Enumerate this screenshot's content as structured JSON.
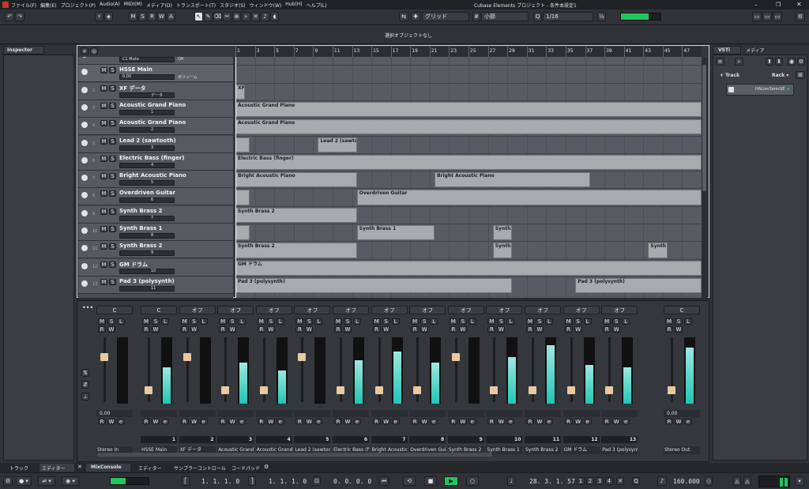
{
  "titlebar": {
    "menus": [
      "ファイル(F)",
      "編集(E)",
      "プロジェクト(P)",
      "Audio(A)",
      "MIDI(M)",
      "メディア(D)",
      "トランスポート(T)",
      "スタジオ(S)",
      "ウィンドウ(W)",
      "Hub(H)",
      "ヘルプ(L)"
    ],
    "title": "Cubase Elements プロジェクト - 条件本設定1"
  },
  "toolbar": {
    "mode_buttons": [
      "M",
      "S",
      "R",
      "W",
      "A"
    ],
    "snap_mode": "グリッド",
    "grid_type": "小節",
    "quantize": "1/16"
  },
  "infobar": {
    "status": "選択オブジェクトなし"
  },
  "left_zone": {
    "tab": "Inspector"
  },
  "bottom_tabs_left": [
    "トラック",
    "エディター"
  ],
  "bottom_tabs_lower": [
    "MixConsole",
    "エディター",
    "サンプラーコントロール",
    "コードパッド"
  ],
  "ruler_bars": [
    "1",
    "3",
    "5",
    "7",
    "9",
    "11",
    "13",
    "15",
    "17",
    "19",
    "21",
    "23",
    "25",
    "27",
    "29",
    "31",
    "33",
    "35",
    "37",
    "39",
    "41",
    "43",
    "45",
    "47"
  ],
  "tracks": [
    {
      "num": "",
      "name": "HALion Sonic SE",
      "sub": "C1 Mute",
      "extra": "Off"
    },
    {
      "num": "",
      "name": "HSSE Main",
      "sub": "0.00",
      "extra": "ボリューム"
    },
    {
      "num": "2",
      "name": "XF データ",
      "ch": "データ"
    },
    {
      "num": "3",
      "name": "Acoustic Grand Piano",
      "ch": "1"
    },
    {
      "num": "4",
      "name": "Acoustic Grand Piano",
      "ch": "2"
    },
    {
      "num": "5",
      "name": "Lead 2 (sawtooth)",
      "ch": "3"
    },
    {
      "num": "6",
      "name": "Electric Bass (finger)",
      "ch": "4"
    },
    {
      "num": "7",
      "name": "Bright Acoustic Piano",
      "ch": "5"
    },
    {
      "num": "8",
      "name": "Overdriven Guitar",
      "ch": "6"
    },
    {
      "num": "9",
      "name": "Synth Brass 2",
      "ch": "7"
    },
    {
      "num": "10",
      "name": "Synth Brass 1",
      "ch": "8"
    },
    {
      "num": "11",
      "name": "Synth Brass 2",
      "ch": "9"
    },
    {
      "num": "12",
      "name": "GM ドラム",
      "ch": "10"
    },
    {
      "num": "13",
      "name": "Pad 3 (polysynth)",
      "ch": "11"
    }
  ],
  "events": [
    {
      "row": 2,
      "start": 0,
      "end": 1,
      "label": "XF デー"
    },
    {
      "row": 3,
      "start": 0,
      "end": 48,
      "label": "Acoustic Grand Piano"
    },
    {
      "row": 4,
      "start": 0,
      "end": 48,
      "label": "Acoustic Grand Piano"
    },
    {
      "row": 5,
      "start": 0,
      "end": 1.5,
      "label": ""
    },
    {
      "row": 5,
      "start": 8.5,
      "end": 12.5,
      "label": "Lead 2 (sawtoot"
    },
    {
      "row": 6,
      "start": 0,
      "end": 48,
      "label": "Electric Bass (finger)"
    },
    {
      "row": 7,
      "start": 0,
      "end": 12.5,
      "label": "Bright Acoustic Piano"
    },
    {
      "row": 7,
      "start": 20.5,
      "end": 36.5,
      "label": "Bright Acoustic Piano"
    },
    {
      "row": 8,
      "start": 0,
      "end": 1.5,
      "label": ""
    },
    {
      "row": 8,
      "start": 12.5,
      "end": 48,
      "label": "Overdriven Guitar"
    },
    {
      "row": 9,
      "start": 0,
      "end": 12.5,
      "label": "Synth Brass 2"
    },
    {
      "row": 10,
      "start": 0,
      "end": 1.5,
      "label": ""
    },
    {
      "row": 10,
      "start": 12.5,
      "end": 20.5,
      "label": "Synth Brass 1"
    },
    {
      "row": 10,
      "start": 26.5,
      "end": 28.5,
      "label": "Synth B"
    },
    {
      "row": 11,
      "start": 0,
      "end": 12.5,
      "label": "Synth Brass 2"
    },
    {
      "row": 11,
      "start": 26.5,
      "end": 28.5,
      "label": "Synth B"
    },
    {
      "row": 11,
      "start": 42.5,
      "end": 44.5,
      "label": "Synth B"
    },
    {
      "row": 12,
      "start": 0,
      "end": 48,
      "label": "GM ドラム"
    },
    {
      "row": 13,
      "start": 0,
      "end": 28.5,
      "label": "Pad 3 (polysynth)"
    },
    {
      "row": 13,
      "start": 35,
      "end": 48,
      "label": "Pad 3 (polysynth)"
    }
  ],
  "mixer": {
    "input": {
      "name": "Stereo In",
      "pan": "C",
      "value": "0.00"
    },
    "channels": [
      {
        "name": "HSSE Main",
        "num": "1",
        "pan": "C",
        "level": 0.55
      },
      {
        "name": "XF データ",
        "num": "2",
        "pan": "オフ",
        "level": 0.0
      },
      {
        "name": "Acoustic Grand",
        "num": "3",
        "pan": "オフ",
        "level": 0.62
      },
      {
        "name": "Acoustic Grand",
        "num": "4",
        "pan": "オフ",
        "level": 0.5
      },
      {
        "name": "Lead 2 (sawtoo",
        "num": "5",
        "pan": "オフ",
        "level": 0.0
      },
      {
        "name": "Electric Bass (fi",
        "num": "6",
        "pan": "オフ",
        "level": 0.66
      },
      {
        "name": "Bright Acoustic",
        "num": "7",
        "pan": "オフ",
        "level": 0.78
      },
      {
        "name": "Overdriven Gui",
        "num": "8",
        "pan": "オフ",
        "level": 0.62
      },
      {
        "name": "Synth Brass 2",
        "num": "9",
        "pan": "オフ",
        "level": 0.0
      },
      {
        "name": "Synth Brass 1",
        "num": "10",
        "pan": "オフ",
        "level": 0.7
      },
      {
        "name": "Synth Brass 2",
        "num": "11",
        "pan": "オフ",
        "level": 0.88
      },
      {
        "name": "GM ドラム",
        "num": "12",
        "pan": "オフ",
        "level": 0.58
      },
      {
        "name": "Pad 3 (polysynt",
        "num": "13",
        "pan": "オフ",
        "level": 0.55
      }
    ],
    "output": {
      "name": "Stereo Out",
      "pan": "C",
      "value": "0.00",
      "level": 0.85
    }
  },
  "right_zone": {
    "tabs": [
      "VSTi",
      "メディア"
    ],
    "track_label": "Track",
    "rack_label": "Rack",
    "instrument": "HALionSonicSE"
  },
  "transport": {
    "left_locator": "1. 1. 1. 0",
    "right_locator": "1. 1. 1. 0",
    "start": "0. 0. 0. 0",
    "position": "28. 3. 1. 57",
    "tempo": "160.000",
    "markers": [
      "1",
      "2",
      "3",
      "4"
    ]
  },
  "colors": {
    "meter": "#1fc6b6",
    "accent_green": "#22c55e",
    "event_grey": "#a8abae"
  }
}
